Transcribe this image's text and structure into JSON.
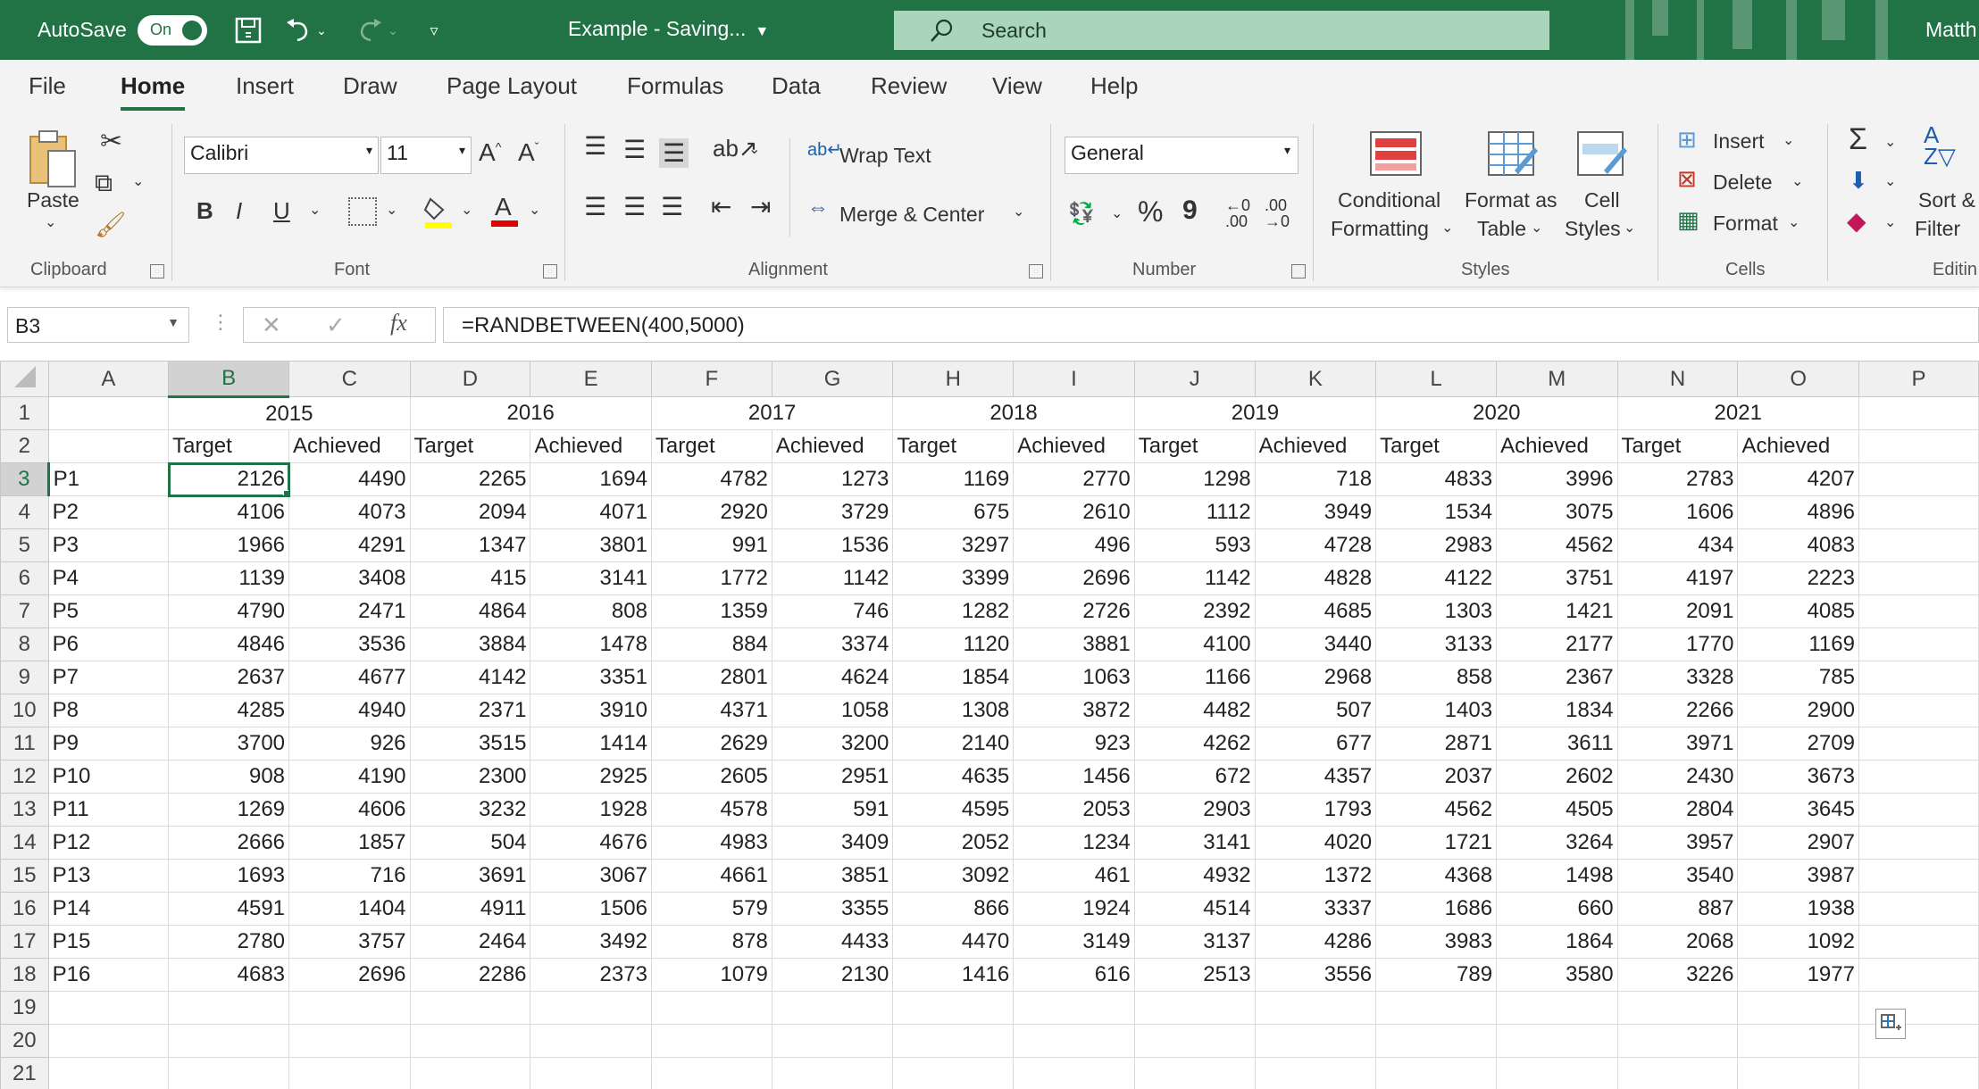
{
  "titlebar": {
    "autosave_label": "AutoSave",
    "autosave_state": "On",
    "document_title": "Example  -  Saving...",
    "search_placeholder": "Search",
    "user": "Matth"
  },
  "tabs": [
    "File",
    "Home",
    "Insert",
    "Draw",
    "Page Layout",
    "Formulas",
    "Data",
    "Review",
    "View",
    "Help"
  ],
  "active_tab": "Home",
  "ribbon": {
    "clipboard": {
      "paste": "Paste",
      "label": "Clipboard"
    },
    "font": {
      "name": "Calibri",
      "size": "11",
      "bold": "B",
      "italic": "I",
      "underline": "U",
      "label": "Font"
    },
    "alignment": {
      "wrap": "Wrap Text",
      "merge": "Merge & Center",
      "label": "Alignment"
    },
    "number": {
      "format": "General",
      "percent": "%",
      "comma": "9",
      "label": "Number"
    },
    "styles": {
      "cond1": "Conditional",
      "cond2": "Formatting",
      "fmt1": "Format as",
      "fmt2": "Table",
      "cell1": "Cell",
      "cell2": "Styles",
      "label": "Styles"
    },
    "cells": {
      "insert": "Insert",
      "delete": "Delete",
      "format": "Format",
      "label": "Cells"
    },
    "editing": {
      "sort1": "Sort &",
      "sort2": "Filter",
      "label": "Editin"
    }
  },
  "formula_bar": {
    "name_box": "B3",
    "fx": "fx",
    "formula": "=RANDBETWEEN(400,5000)"
  },
  "sheet": {
    "columns": [
      "A",
      "B",
      "C",
      "D",
      "E",
      "F",
      "G",
      "H",
      "I",
      "J",
      "K",
      "L",
      "M",
      "N",
      "O",
      "P"
    ],
    "years": [
      "2015",
      "2016",
      "2017",
      "2018",
      "2019",
      "2020",
      "2021"
    ],
    "subheaders": [
      "Target",
      "Achieved"
    ],
    "products": [
      "P1",
      "P2",
      "P3",
      "P4",
      "P5",
      "P6",
      "P7",
      "P8",
      "P9",
      "P10",
      "P11",
      "P12",
      "P13",
      "P14",
      "P15",
      "P16"
    ],
    "values": [
      [
        2126,
        4490,
        2265,
        1694,
        4782,
        1273,
        1169,
        2770,
        1298,
        718,
        4833,
        3996,
        2783,
        4207
      ],
      [
        4106,
        4073,
        2094,
        4071,
        2920,
        3729,
        675,
        2610,
        1112,
        3949,
        1534,
        3075,
        1606,
        4896
      ],
      [
        1966,
        4291,
        1347,
        3801,
        991,
        1536,
        3297,
        496,
        593,
        4728,
        2983,
        4562,
        434,
        4083
      ],
      [
        1139,
        3408,
        415,
        3141,
        1772,
        1142,
        3399,
        2696,
        1142,
        4828,
        4122,
        3751,
        4197,
        2223
      ],
      [
        4790,
        2471,
        4864,
        808,
        1359,
        746,
        1282,
        2726,
        2392,
        4685,
        1303,
        1421,
        2091,
        4085
      ],
      [
        4846,
        3536,
        3884,
        1478,
        884,
        3374,
        1120,
        3881,
        4100,
        3440,
        3133,
        2177,
        1770,
        1169
      ],
      [
        2637,
        4677,
        4142,
        3351,
        2801,
        4624,
        1854,
        1063,
        1166,
        2968,
        858,
        2367,
        3328,
        785
      ],
      [
        4285,
        4940,
        2371,
        3910,
        4371,
        1058,
        1308,
        3872,
        4482,
        507,
        1403,
        1834,
        2266,
        2900
      ],
      [
        3700,
        926,
        3515,
        1414,
        2629,
        3200,
        2140,
        923,
        4262,
        677,
        2871,
        3611,
        3971,
        2709
      ],
      [
        908,
        4190,
        2300,
        2925,
        2605,
        2951,
        4635,
        1456,
        672,
        4357,
        2037,
        2602,
        2430,
        3673
      ],
      [
        1269,
        4606,
        3232,
        1928,
        4578,
        591,
        4595,
        2053,
        2903,
        1793,
        4562,
        4505,
        2804,
        3645
      ],
      [
        2666,
        1857,
        504,
        4676,
        4983,
        3409,
        2052,
        1234,
        3141,
        4020,
        1721,
        3264,
        3957,
        2907
      ],
      [
        1693,
        716,
        3691,
        3067,
        4661,
        3851,
        3092,
        461,
        4932,
        1372,
        4368,
        1498,
        3540,
        3987
      ],
      [
        4591,
        1404,
        4911,
        1506,
        579,
        3355,
        866,
        1924,
        4514,
        3337,
        1686,
        660,
        887,
        1938
      ],
      [
        2780,
        3757,
        2464,
        3492,
        878,
        4433,
        4470,
        3149,
        3137,
        4286,
        3983,
        1864,
        2068,
        1092
      ],
      [
        4683,
        2696,
        2286,
        2373,
        1079,
        2130,
        1416,
        616,
        2513,
        3556,
        789,
        3580,
        3226,
        1977
      ]
    ],
    "active_cell": "B3",
    "colors": {
      "accent": "#217346",
      "search_bg": "#a9d5bb"
    }
  }
}
